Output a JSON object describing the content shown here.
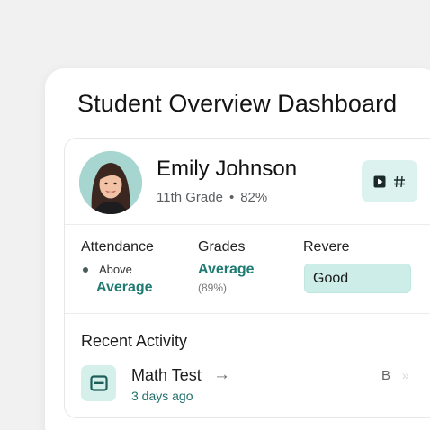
{
  "page": {
    "title": "Student Overview Dashboard"
  },
  "student": {
    "name": "Emily Johnson",
    "grade": "11th Grade",
    "separator": "•",
    "score": "82%"
  },
  "actions": {
    "icons": [
      "play-square-icon",
      "hash-icon"
    ]
  },
  "stats": {
    "attendance": {
      "label": "Attendance",
      "sub": "Above",
      "value": "Average"
    },
    "grades": {
      "label": "Grades",
      "value": "Average",
      "pct": "(89%)"
    },
    "review": {
      "label": "Revere",
      "badge": "Good"
    }
  },
  "recent_activity": {
    "title": "Recent Activity",
    "items": [
      {
        "title": "Math Test",
        "arrow": "→",
        "time": "3 days ago",
        "grade": "B",
        "icon": "card-icon"
      }
    ]
  },
  "colors": {
    "accent": "#1f7a72",
    "accent_light": "#d5efeb",
    "badge_bg": "#cdeee8"
  }
}
